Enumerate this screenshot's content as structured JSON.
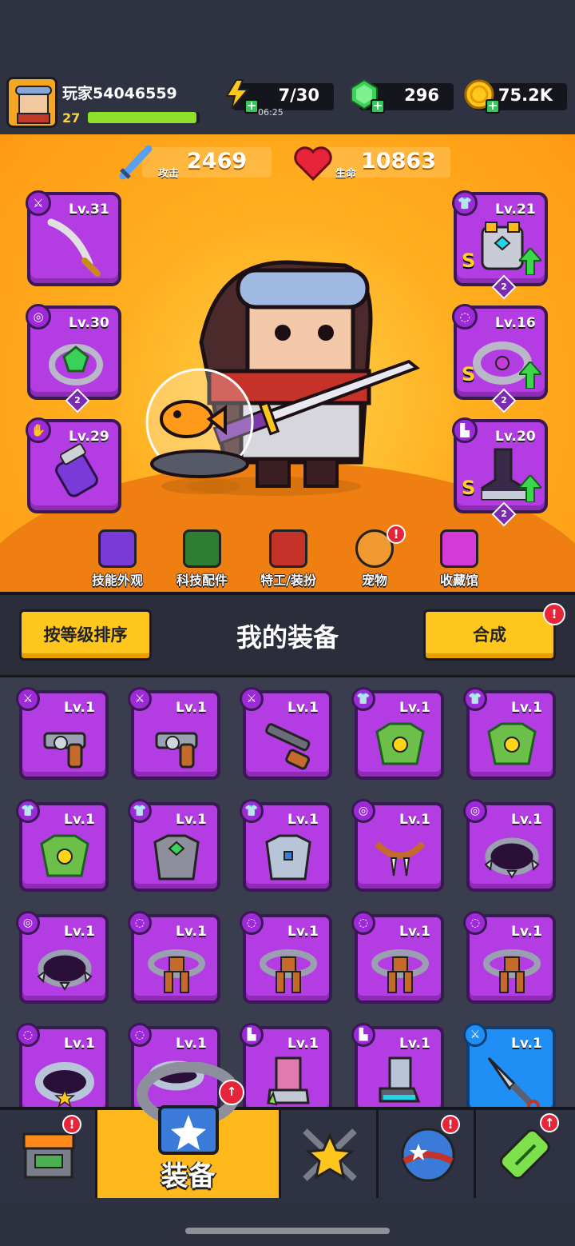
{
  "player": {
    "name": "玩家54046559",
    "level": "27",
    "xp_fraction": 0.97
  },
  "resources": {
    "energy": "7/30",
    "energy_timer": "06:25",
    "gems": "296",
    "coins": "75.2K"
  },
  "stats": {
    "attack_label": "攻击",
    "attack_value": "2469",
    "hp_label": "生命",
    "hp_value": "10863"
  },
  "equipped": {
    "left": [
      {
        "level": "Lv.31",
        "icon": "sword-icon",
        "stars": ""
      },
      {
        "level": "Lv.30",
        "icon": "ring-icon",
        "stars": "2"
      },
      {
        "level": "Lv.29",
        "icon": "glove-icon",
        "stars": ""
      }
    ],
    "right": [
      {
        "level": "Lv.21",
        "icon": "armor-icon",
        "stars": "2",
        "grade": "S"
      },
      {
        "level": "Lv.16",
        "icon": "belt-icon",
        "stars": "2",
        "grade": "S"
      },
      {
        "level": "Lv.20",
        "icon": "boots-icon",
        "stars": "2",
        "grade": "S"
      }
    ]
  },
  "hero_nav": [
    {
      "label": "技能外观",
      "icon": "skill-skin-icon"
    },
    {
      "label": "科技配件",
      "icon": "tech-part-icon"
    },
    {
      "label": "特工/装扮",
      "icon": "agent-costume-icon"
    },
    {
      "label": "宠物",
      "icon": "pet-icon",
      "alert": "!"
    },
    {
      "label": "收藏馆",
      "icon": "collection-icon"
    }
  ],
  "inventory": {
    "sort_button": "按等级排序",
    "title": "我的装备",
    "merge_button": "合成",
    "merge_alert": "!",
    "items": [
      {
        "level": "Lv.1",
        "type": "weapon",
        "art": "revolver"
      },
      {
        "level": "Lv.1",
        "type": "weapon",
        "art": "revolver"
      },
      {
        "level": "Lv.1",
        "type": "weapon",
        "art": "shotgun"
      },
      {
        "level": "Lv.1",
        "type": "armor",
        "art": "leaf-armor"
      },
      {
        "level": "Lv.1",
        "type": "armor",
        "art": "leaf-armor"
      },
      {
        "level": "Lv.1",
        "type": "armor",
        "art": "leaf-armor"
      },
      {
        "level": "Lv.1",
        "type": "armor",
        "art": "stone-armor"
      },
      {
        "level": "Lv.1",
        "type": "armor",
        "art": "steel-armor"
      },
      {
        "level": "Lv.1",
        "type": "necklace",
        "art": "fang-necklace"
      },
      {
        "level": "Lv.1",
        "type": "necklace",
        "art": "spike-collar"
      },
      {
        "level": "Lv.1",
        "type": "necklace",
        "art": "spike-collar"
      },
      {
        "level": "Lv.1",
        "type": "belt",
        "art": "rope-belt"
      },
      {
        "level": "Lv.1",
        "type": "belt",
        "art": "rope-belt"
      },
      {
        "level": "Lv.1",
        "type": "belt",
        "art": "rope-belt"
      },
      {
        "level": "Lv.1",
        "type": "belt",
        "art": "rope-belt"
      },
      {
        "level": "Lv.1",
        "type": "belt",
        "art": "star-belt"
      },
      {
        "level": "Lv.1",
        "type": "belt",
        "art": "metal-belt"
      },
      {
        "level": "Lv.1",
        "type": "boots",
        "art": "claw-boot"
      },
      {
        "level": "Lv.1",
        "type": "boots",
        "art": "tech-boot"
      },
      {
        "level": "Lv.1",
        "type": "weapon",
        "art": "kunai",
        "rarity": "blue"
      }
    ]
  },
  "bottom_nav": [
    {
      "label": "",
      "icon": "shop-icon",
      "alert": "!"
    },
    {
      "label": "装备",
      "icon": "equipment-icon",
      "active": true,
      "alert": "↑"
    },
    {
      "label": "",
      "icon": "star-swords-icon"
    },
    {
      "label": "",
      "icon": "world-icon",
      "alert": "!"
    },
    {
      "label": "",
      "icon": "dna-capsule-icon",
      "alert": "↑"
    }
  ],
  "colors": {
    "epic_purple": "#b33de2",
    "rare_blue": "#1f8ff5",
    "accent_yellow": "#ffc61e",
    "alert_red": "#e8243a"
  }
}
